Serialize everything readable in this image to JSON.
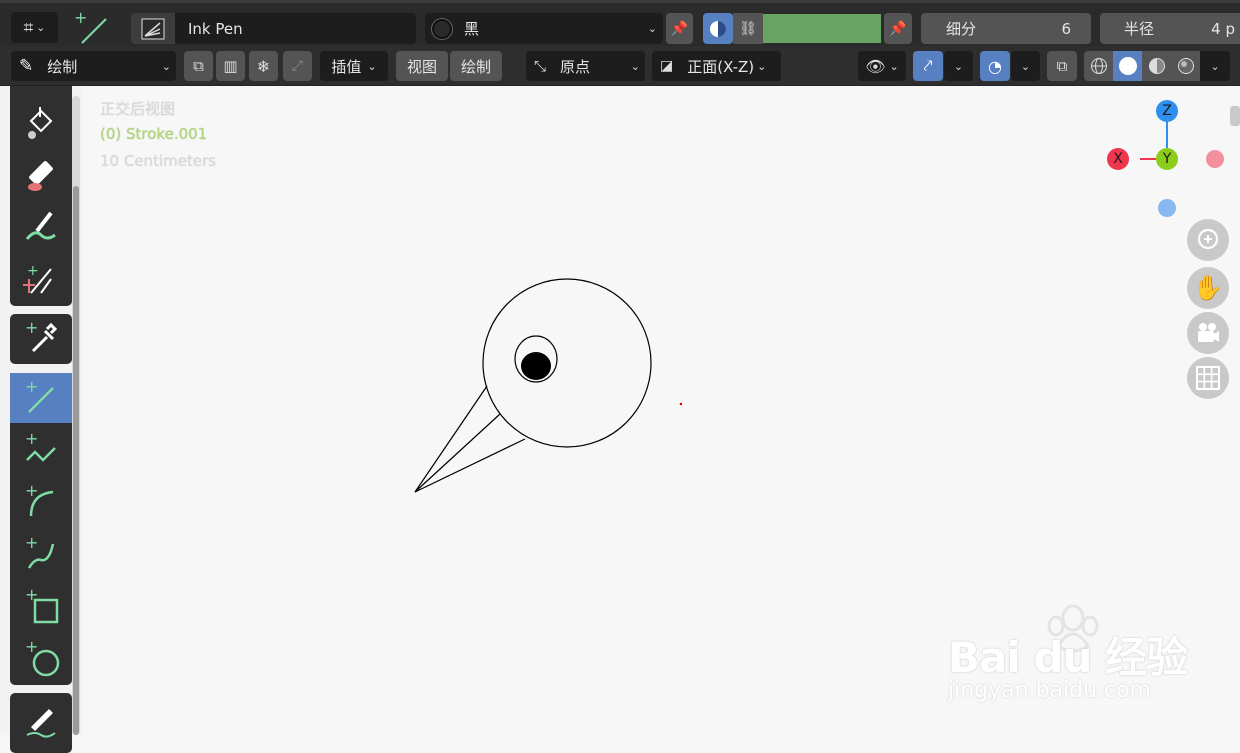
{
  "header": {
    "brush_name": "Ink Pen",
    "material_name": "黑",
    "subdivision_label": "细分",
    "subdivision_value": "6",
    "radius_label": "半径",
    "radius_value": "4 p",
    "color_swatch": "#6aa464"
  },
  "toolbar2": {
    "mode": "绘制",
    "interpolate": "插值",
    "view_button": "视图",
    "draw_button": "绘制",
    "origin": "原点",
    "orientation": "正面(X-Z)"
  },
  "viewport": {
    "view_name": "正交后视图",
    "object_name": "(0) Stroke.001",
    "scale": "10 Centimeters"
  },
  "gizmo": {
    "z": "Z",
    "x": "X",
    "y": "Y"
  },
  "watermark": {
    "brand": "Bai du 经验",
    "url": "jingyan.baidu.com"
  },
  "colors": {
    "accent_blue": "#5680c2",
    "tool_green": "#7fdca4",
    "axis_x": "#f0364f",
    "axis_y": "#8ccc1a",
    "axis_z": "#2e8ff0"
  }
}
